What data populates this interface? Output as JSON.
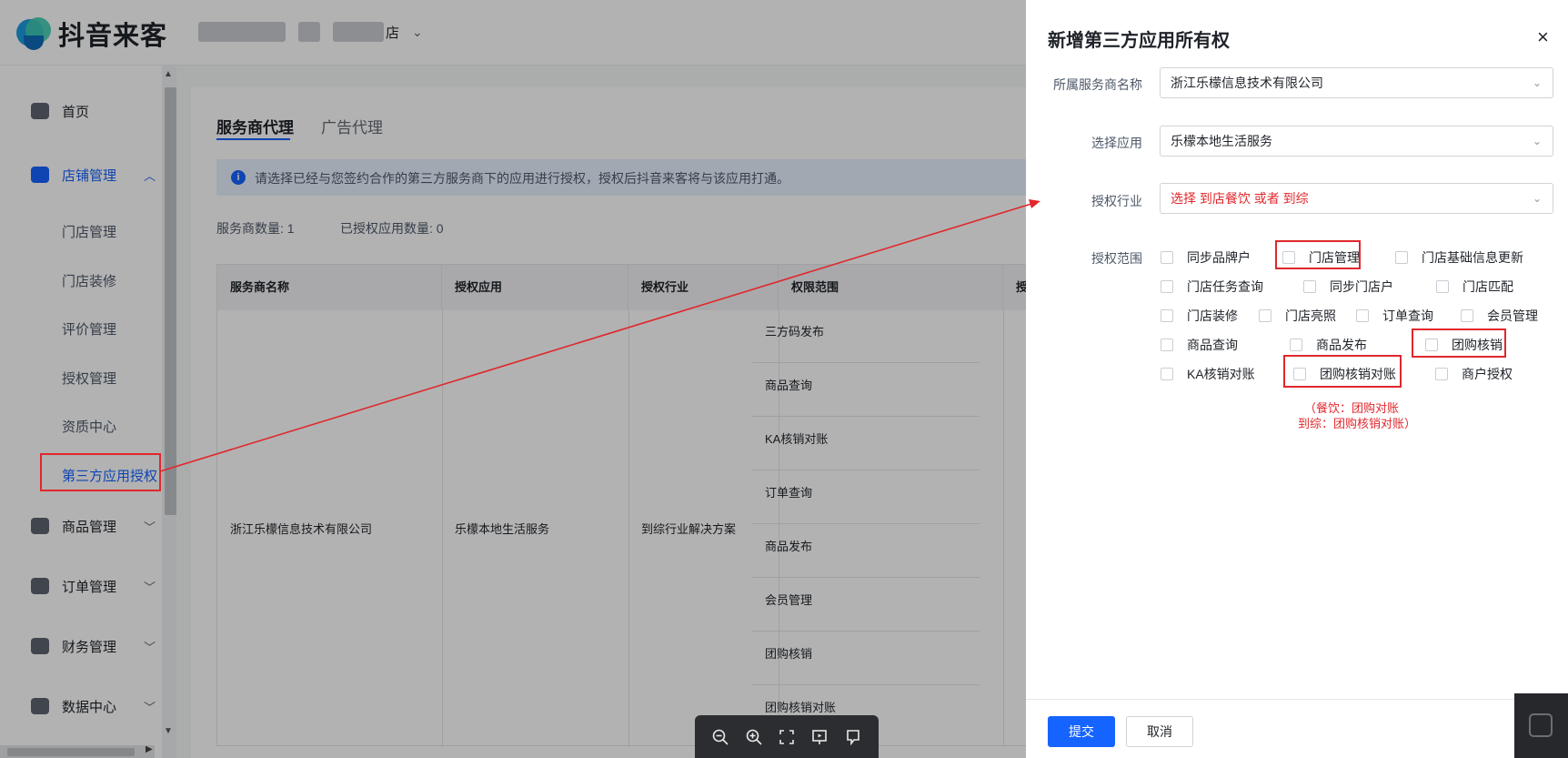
{
  "header": {
    "logo_text": "抖音来客",
    "shop_name_suffix": "店",
    "shop_chevron": "⌄"
  },
  "sidebar": {
    "items": [
      {
        "label": "首页",
        "icon": "home-icon"
      },
      {
        "label": "店铺管理",
        "icon": "store-icon",
        "arrow": "︿"
      },
      {
        "label": "商品管理",
        "icon": "goods-icon",
        "arrow": "﹀"
      },
      {
        "label": "订单管理",
        "icon": "order-icon",
        "arrow": "﹀"
      },
      {
        "label": "财务管理",
        "icon": "finance-icon",
        "arrow": "﹀"
      },
      {
        "label": "数据中心",
        "icon": "data-icon",
        "arrow": "﹀"
      }
    ],
    "sub_items": [
      "门店管理",
      "门店装修",
      "评价管理",
      "授权管理",
      "资质中心",
      "第三方应用授权"
    ]
  },
  "main": {
    "tabs": [
      "服务商代理",
      "广告代理"
    ],
    "notice": "请选择已经与您签约合作的第三方服务商下的应用进行授权，授权后抖音来客将与该应用打通。",
    "provider_count": "服务商数量: 1",
    "authorized_count": "已授权应用数量: 0",
    "table": {
      "headers": [
        "服务商名称",
        "授权应用",
        "授权行业",
        "权限范围",
        "授"
      ],
      "provider": "浙江乐檬信息技术有限公司",
      "app": "乐檬本地生活服务",
      "industry": "到综行业解决方案",
      "scopes": [
        "三方码发布",
        "商品查询",
        "KA核销对账",
        "订单查询",
        "商品发布",
        "会员管理",
        "团购核销",
        "团购核销对账"
      ]
    }
  },
  "drawer": {
    "title": "新增第三方应用所有权",
    "close": "×",
    "fields": {
      "provider_label": "所属服务商名称",
      "provider_value": "浙江乐檬信息技术有限公司",
      "app_label": "选择应用",
      "app_value": "乐檬本地生活服务",
      "industry_label": "授权行业",
      "industry_value": "选择 到店餐饮 或者 到综",
      "scope_label": "授权范围"
    },
    "scopes": [
      "同步品牌户",
      "门店管理",
      "门店基础信息更新",
      "门店任务查询",
      "同步门店户",
      "门店匹配",
      "门店装修",
      "门店亮照",
      "订单查询",
      "会员管理",
      "商品查询",
      "商品发布",
      "团购核销",
      "KA核销对账",
      "团购核销对账",
      "商户授权"
    ],
    "note_line1": "（餐饮：团购对账",
    "note_line2": "到综：团购核销对账）",
    "submit": "提交",
    "cancel": "取消"
  },
  "colors": {
    "primary": "#1664ff",
    "annotation_red": "#e0272c"
  }
}
